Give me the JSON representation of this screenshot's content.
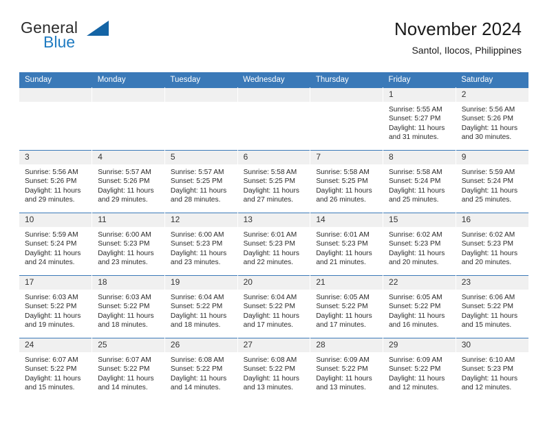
{
  "brand": {
    "name_top": "General",
    "name_bottom": "Blue",
    "triangle_color": "#1464a5",
    "blue_color": "#1f7bc1"
  },
  "header": {
    "title": "November 2024",
    "subtitle": "Santol, Ilocos, Philippines"
  },
  "theme": {
    "header_row_bg": "#3a79b8",
    "header_row_text": "#ffffff",
    "daynum_bg": "#f0f0f0",
    "cell_bg": "#ffffff",
    "row_border": "#3a79b8"
  },
  "weekdays": [
    "Sunday",
    "Monday",
    "Tuesday",
    "Wednesday",
    "Thursday",
    "Friday",
    "Saturday"
  ],
  "labels": {
    "sunrise": "Sunrise:",
    "sunset": "Sunset:",
    "daylight": "Daylight:"
  },
  "weeks": [
    [
      {
        "empty": true
      },
      {
        "empty": true
      },
      {
        "empty": true
      },
      {
        "empty": true
      },
      {
        "empty": true
      },
      {
        "day": "1",
        "sunrise": "Sunrise: 5:55 AM",
        "sunset": "Sunset: 5:27 PM",
        "daylight": "Daylight: 11 hours and 31 minutes."
      },
      {
        "day": "2",
        "sunrise": "Sunrise: 5:56 AM",
        "sunset": "Sunset: 5:26 PM",
        "daylight": "Daylight: 11 hours and 30 minutes."
      }
    ],
    [
      {
        "day": "3",
        "sunrise": "Sunrise: 5:56 AM",
        "sunset": "Sunset: 5:26 PM",
        "daylight": "Daylight: 11 hours and 29 minutes."
      },
      {
        "day": "4",
        "sunrise": "Sunrise: 5:57 AM",
        "sunset": "Sunset: 5:26 PM",
        "daylight": "Daylight: 11 hours and 29 minutes."
      },
      {
        "day": "5",
        "sunrise": "Sunrise: 5:57 AM",
        "sunset": "Sunset: 5:25 PM",
        "daylight": "Daylight: 11 hours and 28 minutes."
      },
      {
        "day": "6",
        "sunrise": "Sunrise: 5:58 AM",
        "sunset": "Sunset: 5:25 PM",
        "daylight": "Daylight: 11 hours and 27 minutes."
      },
      {
        "day": "7",
        "sunrise": "Sunrise: 5:58 AM",
        "sunset": "Sunset: 5:25 PM",
        "daylight": "Daylight: 11 hours and 26 minutes."
      },
      {
        "day": "8",
        "sunrise": "Sunrise: 5:58 AM",
        "sunset": "Sunset: 5:24 PM",
        "daylight": "Daylight: 11 hours and 25 minutes."
      },
      {
        "day": "9",
        "sunrise": "Sunrise: 5:59 AM",
        "sunset": "Sunset: 5:24 PM",
        "daylight": "Daylight: 11 hours and 25 minutes."
      }
    ],
    [
      {
        "day": "10",
        "sunrise": "Sunrise: 5:59 AM",
        "sunset": "Sunset: 5:24 PM",
        "daylight": "Daylight: 11 hours and 24 minutes."
      },
      {
        "day": "11",
        "sunrise": "Sunrise: 6:00 AM",
        "sunset": "Sunset: 5:23 PM",
        "daylight": "Daylight: 11 hours and 23 minutes."
      },
      {
        "day": "12",
        "sunrise": "Sunrise: 6:00 AM",
        "sunset": "Sunset: 5:23 PM",
        "daylight": "Daylight: 11 hours and 23 minutes."
      },
      {
        "day": "13",
        "sunrise": "Sunrise: 6:01 AM",
        "sunset": "Sunset: 5:23 PM",
        "daylight": "Daylight: 11 hours and 22 minutes."
      },
      {
        "day": "14",
        "sunrise": "Sunrise: 6:01 AM",
        "sunset": "Sunset: 5:23 PM",
        "daylight": "Daylight: 11 hours and 21 minutes."
      },
      {
        "day": "15",
        "sunrise": "Sunrise: 6:02 AM",
        "sunset": "Sunset: 5:23 PM",
        "daylight": "Daylight: 11 hours and 20 minutes."
      },
      {
        "day": "16",
        "sunrise": "Sunrise: 6:02 AM",
        "sunset": "Sunset: 5:23 PM",
        "daylight": "Daylight: 11 hours and 20 minutes."
      }
    ],
    [
      {
        "day": "17",
        "sunrise": "Sunrise: 6:03 AM",
        "sunset": "Sunset: 5:22 PM",
        "daylight": "Daylight: 11 hours and 19 minutes."
      },
      {
        "day": "18",
        "sunrise": "Sunrise: 6:03 AM",
        "sunset": "Sunset: 5:22 PM",
        "daylight": "Daylight: 11 hours and 18 minutes."
      },
      {
        "day": "19",
        "sunrise": "Sunrise: 6:04 AM",
        "sunset": "Sunset: 5:22 PM",
        "daylight": "Daylight: 11 hours and 18 minutes."
      },
      {
        "day": "20",
        "sunrise": "Sunrise: 6:04 AM",
        "sunset": "Sunset: 5:22 PM",
        "daylight": "Daylight: 11 hours and 17 minutes."
      },
      {
        "day": "21",
        "sunrise": "Sunrise: 6:05 AM",
        "sunset": "Sunset: 5:22 PM",
        "daylight": "Daylight: 11 hours and 17 minutes."
      },
      {
        "day": "22",
        "sunrise": "Sunrise: 6:05 AM",
        "sunset": "Sunset: 5:22 PM",
        "daylight": "Daylight: 11 hours and 16 minutes."
      },
      {
        "day": "23",
        "sunrise": "Sunrise: 6:06 AM",
        "sunset": "Sunset: 5:22 PM",
        "daylight": "Daylight: 11 hours and 15 minutes."
      }
    ],
    [
      {
        "day": "24",
        "sunrise": "Sunrise: 6:07 AM",
        "sunset": "Sunset: 5:22 PM",
        "daylight": "Daylight: 11 hours and 15 minutes."
      },
      {
        "day": "25",
        "sunrise": "Sunrise: 6:07 AM",
        "sunset": "Sunset: 5:22 PM",
        "daylight": "Daylight: 11 hours and 14 minutes."
      },
      {
        "day": "26",
        "sunrise": "Sunrise: 6:08 AM",
        "sunset": "Sunset: 5:22 PM",
        "daylight": "Daylight: 11 hours and 14 minutes."
      },
      {
        "day": "27",
        "sunrise": "Sunrise: 6:08 AM",
        "sunset": "Sunset: 5:22 PM",
        "daylight": "Daylight: 11 hours and 13 minutes."
      },
      {
        "day": "28",
        "sunrise": "Sunrise: 6:09 AM",
        "sunset": "Sunset: 5:22 PM",
        "daylight": "Daylight: 11 hours and 13 minutes."
      },
      {
        "day": "29",
        "sunrise": "Sunrise: 6:09 AM",
        "sunset": "Sunset: 5:22 PM",
        "daylight": "Daylight: 11 hours and 12 minutes."
      },
      {
        "day": "30",
        "sunrise": "Sunrise: 6:10 AM",
        "sunset": "Sunset: 5:23 PM",
        "daylight": "Daylight: 11 hours and 12 minutes."
      }
    ]
  ]
}
